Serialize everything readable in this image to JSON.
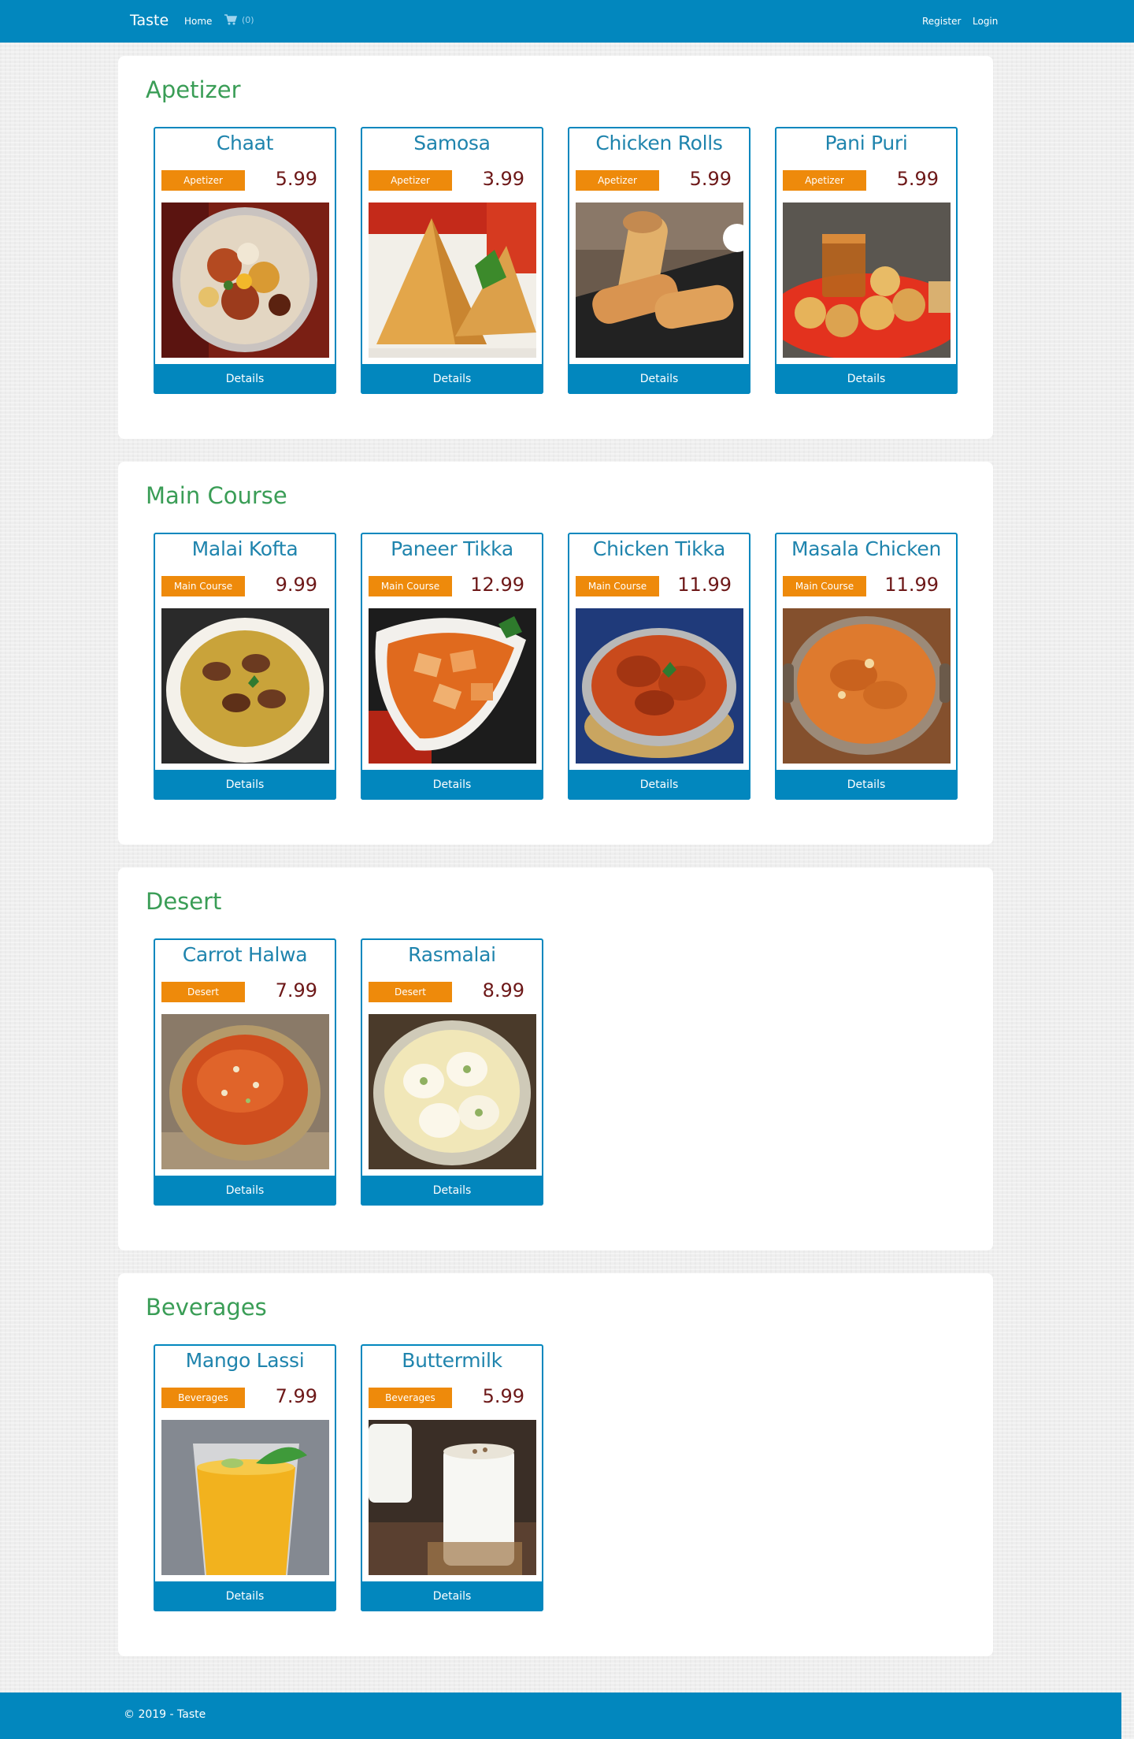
{
  "nav": {
    "brand": "Taste",
    "home": "Home",
    "cart_count": "(0)",
    "register": "Register",
    "login": "Login"
  },
  "colors": {
    "primary": "#0287be",
    "category_title": "#3a9d56",
    "badge": "#ee8a0b",
    "price": "#6d1818"
  },
  "sections": [
    {
      "title": "Apetizer",
      "items": [
        {
          "name": "Chaat",
          "badge": "Apetizer",
          "price": "5.99",
          "button": "Details",
          "photo": "chaat"
        },
        {
          "name": "Samosa",
          "badge": "Apetizer",
          "price": "3.99",
          "button": "Details",
          "photo": "samosa"
        },
        {
          "name": "Chicken Rolls",
          "badge": "Apetizer",
          "price": "5.99",
          "button": "Details",
          "photo": "rolls"
        },
        {
          "name": "Pani Puri",
          "badge": "Apetizer",
          "price": "5.99",
          "button": "Details",
          "photo": "panipuri"
        }
      ]
    },
    {
      "title": "Main Course",
      "items": [
        {
          "name": "Malai Kofta",
          "badge": "Main Course",
          "price": "9.99",
          "button": "Details",
          "photo": "kofta"
        },
        {
          "name": "Paneer Tikka",
          "badge": "Main Course",
          "price": "12.99",
          "button": "Details",
          "photo": "paneer"
        },
        {
          "name": "Chicken Tikka",
          "badge": "Main Course",
          "price": "11.99",
          "button": "Details",
          "photo": "chickentikka"
        },
        {
          "name": "Masala Chicken",
          "badge": "Main Course",
          "price": "11.99",
          "button": "Details",
          "photo": "masala"
        }
      ]
    },
    {
      "title": "Desert",
      "items": [
        {
          "name": "Carrot Halwa",
          "badge": "Desert",
          "price": "7.99",
          "button": "Details",
          "photo": "halwa"
        },
        {
          "name": "Rasmalai",
          "badge": "Desert",
          "price": "8.99",
          "button": "Details",
          "photo": "rasmalai"
        }
      ]
    },
    {
      "title": "Beverages",
      "items": [
        {
          "name": "Mango Lassi",
          "badge": "Beverages",
          "price": "7.99",
          "button": "Details",
          "photo": "lassi"
        },
        {
          "name": "Buttermilk",
          "badge": "Beverages",
          "price": "5.99",
          "button": "Details",
          "photo": "buttermilk"
        }
      ]
    }
  ],
  "footer": {
    "text": "© 2019 - Taste"
  }
}
